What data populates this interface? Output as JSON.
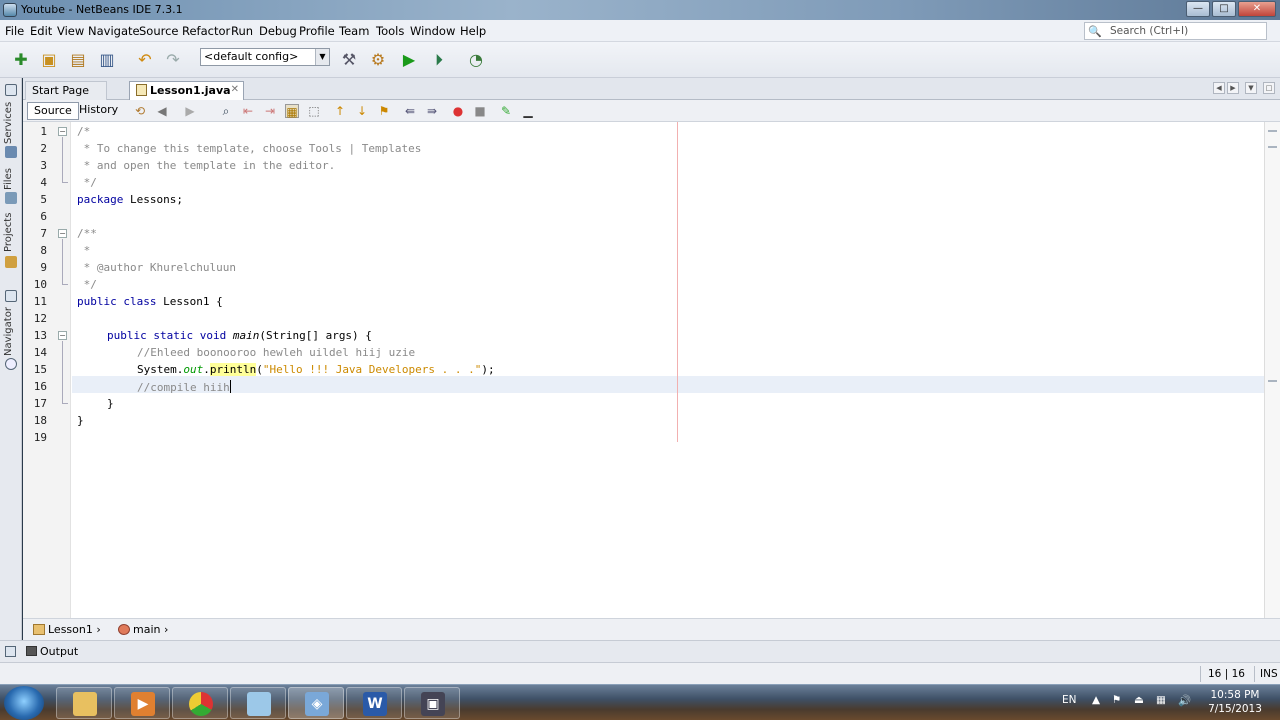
{
  "window": {
    "title": "Youtube - NetBeans IDE 7.3.1",
    "minimize": "—",
    "maximize": "□",
    "close": "✕"
  },
  "menu": [
    "File",
    "Edit",
    "View",
    "Navigate",
    "Source",
    "Refactor",
    "Run",
    "Debug",
    "Profile",
    "Team",
    "Tools",
    "Window",
    "Help"
  ],
  "search": {
    "placeholder": "Search (Ctrl+I)"
  },
  "toolbar": {
    "config": "<default config>"
  },
  "side_tabs": [
    "Services",
    "Files",
    "Projects",
    "Navigator"
  ],
  "tabs": [
    {
      "label": "Start Page",
      "active": false
    },
    {
      "label": "Lesson1.java",
      "active": true
    }
  ],
  "editor_toolbar": {
    "source": "Source",
    "history": "History"
  },
  "line_numbers": [
    "1",
    "2",
    "3",
    "4",
    "5",
    "6",
    "7",
    "8",
    "9",
    "10",
    "11",
    "12",
    "13",
    "14",
    "15",
    "16",
    "17",
    "18",
    "19"
  ],
  "code": {
    "l1": "/*",
    "l2": " * To change this template, choose Tools | Templates",
    "l3": " * and open the template in the editor.",
    "l4": " */",
    "l5_kw": "package",
    "l5_rest": " Lessons;",
    "l7": "/**",
    "l8": " *",
    "l9": " * @author Khurelchuluun",
    "l10": " */",
    "l11_kw": "public class",
    "l11_rest": " Lesson1 {",
    "l13_kw": "public static void",
    "l13_m": "main",
    "l13_rest": "(String[] args) {",
    "l14": "//Ehleed boonooroo hewleh uildel hiij uzie",
    "l15_a": "System.",
    "l15_f": "out",
    "l15_b": ".",
    "l15_m": "println",
    "l15_c": "(",
    "l15_s": "\"Hello !!! Java Developers . . .\"",
    "l15_d": ");",
    "l16": "//compile hiih",
    "l17": "}",
    "l18": "}"
  },
  "breadcrumbs": [
    "Lesson1",
    "main"
  ],
  "output_tab": "Output",
  "status": {
    "position": "16 | 16",
    "mode": "INS"
  },
  "taskbar": {
    "apps": [
      "explorer",
      "media-player",
      "chrome",
      "notepad",
      "virtualbox",
      "word",
      "camtasia"
    ],
    "language": "EN",
    "time": "10:58 PM",
    "date": "7/15/2013"
  }
}
